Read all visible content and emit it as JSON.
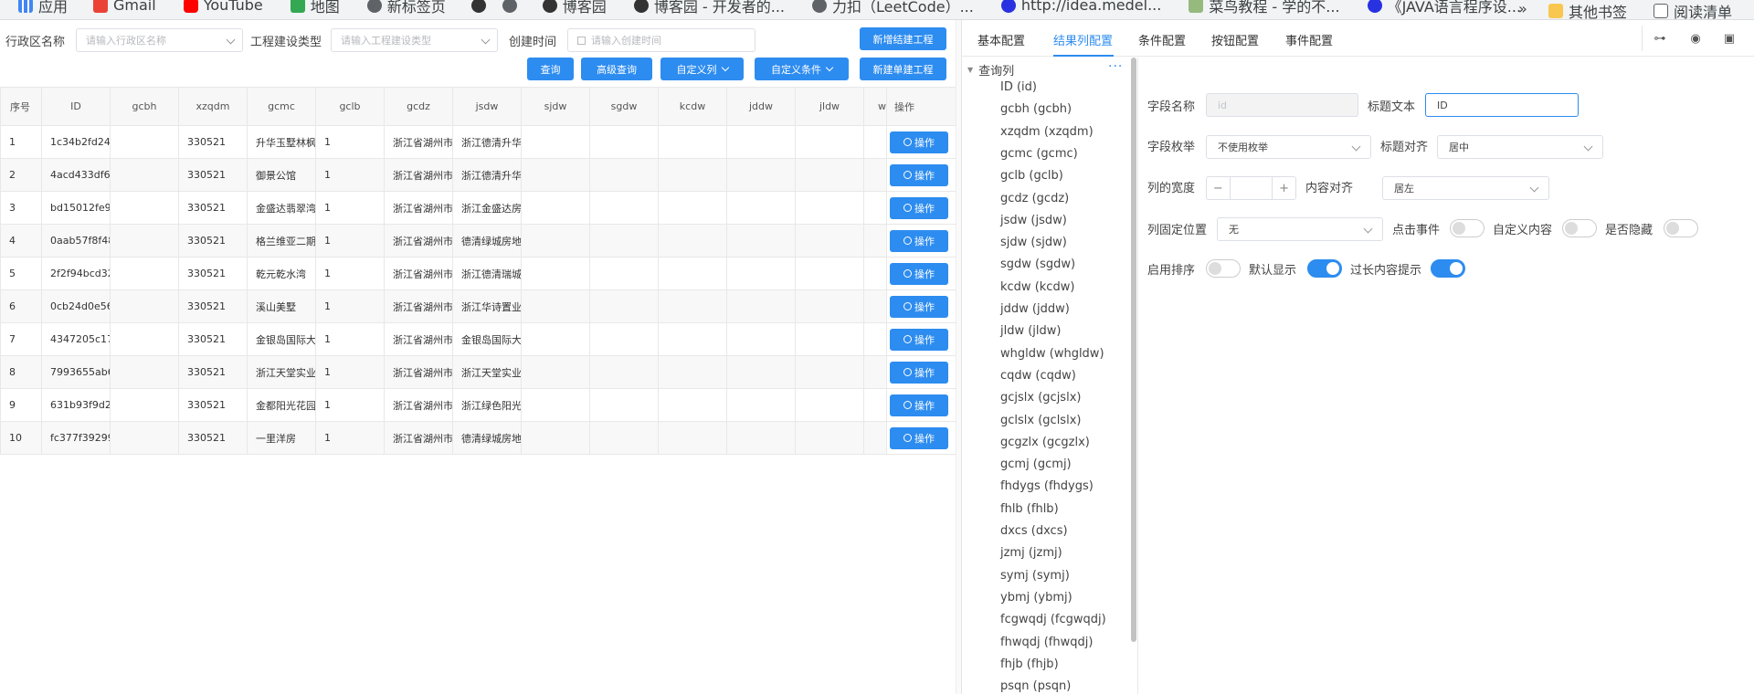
{
  "bookmarks": [
    {
      "label": "应用",
      "icon": "apps-grid-icon",
      "color": "#4285f4"
    },
    {
      "label": "Gmail",
      "icon": "gmail-icon",
      "color": "#ea4335"
    },
    {
      "label": "YouTube",
      "icon": "youtube-icon",
      "color": "#ff0000"
    },
    {
      "label": "地图",
      "icon": "maps-icon",
      "color": "#34a853"
    },
    {
      "label": "新标签页",
      "icon": "globe-icon",
      "color": "#5f6368"
    },
    {
      "label": "",
      "icon": "cnblogs-icon",
      "color": "#333333"
    },
    {
      "label": "",
      "icon": "globe-icon",
      "color": "#5f6368"
    },
    {
      "label": "博客园",
      "icon": "cnblogs-icon",
      "color": "#333333"
    },
    {
      "label": "博客园 - 开发者的...",
      "icon": "cnblogs-icon",
      "color": "#333333"
    },
    {
      "label": "力扣（LeetCode）...",
      "icon": "globe-icon",
      "color": "#5f6368"
    },
    {
      "label": "http://idea.medel...",
      "icon": "link-icon",
      "color": "#2932e1"
    },
    {
      "label": "菜鸟教程 - 学的不...",
      "icon": "runoob-icon",
      "color": "#96b97d"
    },
    {
      "label": "《JAVA语言程序设...",
      "icon": "baidu-icon",
      "color": "#2932e1"
    }
  ],
  "bookmarks_right": {
    "more": "»",
    "other": "其他书签",
    "reading": "阅读清单"
  },
  "filters": {
    "region_label": "行政区名称",
    "region_placeholder": "请输入行政区名称",
    "type_label": "工程建设类型",
    "type_placeholder": "请输入工程建设类型",
    "time_label": "创建时间",
    "time_placeholder": "请输入创建时间"
  },
  "buttons": {
    "new_completed": "新增结建工程",
    "query": "查询",
    "advanced_query": "高级查询",
    "custom_columns": "自定义列",
    "custom_conditions": "自定义条件",
    "new_single": "新建单建工程"
  },
  "table": {
    "headers": [
      "序号",
      "ID",
      "gcbh",
      "xzqdm",
      "gcmc",
      "gclb",
      "gcdz",
      "jsdw",
      "sjdw",
      "sgdw",
      "kcdw",
      "jddw",
      "jldw",
      "w",
      "操作"
    ],
    "op_label": "操作",
    "rows": [
      [
        "1",
        "1c34b2fd24(",
        "",
        "330521",
        "升华玉墅林枫",
        "1",
        "浙江省湖州市",
        "浙江德清升华",
        "",
        "",
        "",
        "",
        "",
        ""
      ],
      [
        "2",
        "4acd433df6l",
        "",
        "330521",
        "御景公馆",
        "1",
        "浙江省湖州市",
        "浙江德清升华",
        "",
        "",
        "",
        "",
        "",
        ""
      ],
      [
        "3",
        "bd15012fe9(",
        "",
        "330521",
        "金盛达翡翠湾",
        "1",
        "浙江省湖州市",
        "浙江金盛达房",
        "",
        "",
        "",
        "",
        "",
        ""
      ],
      [
        "4",
        "0aab57f8f48",
        "",
        "330521",
        "格兰维亚二期",
        "1",
        "浙江省湖州市",
        "德清绿城房地",
        "",
        "",
        "",
        "",
        "",
        ""
      ],
      [
        "5",
        "2f2f94bcd32",
        "",
        "330521",
        "乾元乾水湾",
        "1",
        "浙江省湖州市",
        "浙江德清瑞城",
        "",
        "",
        "",
        "",
        "",
        ""
      ],
      [
        "6",
        "0cb24d0e56",
        "",
        "330521",
        "溪山美墅",
        "1",
        "浙江省湖州市",
        "浙江华诗置业",
        "",
        "",
        "",
        "",
        "",
        ""
      ],
      [
        "7",
        "4347205c17:",
        "",
        "330521",
        "金银岛国际大",
        "1",
        "浙江省湖州市",
        "金银岛国际大",
        "",
        "",
        "",
        "",
        "",
        ""
      ],
      [
        "8",
        "7993655ab6",
        "",
        "330521",
        "浙江天堂实业",
        "1",
        "浙江省湖州市",
        "浙江天堂实业",
        "",
        "",
        "",
        "",
        "",
        ""
      ],
      [
        "9",
        "631b93f9d2l",
        "",
        "330521",
        "金都阳光花园",
        "1",
        "浙江省湖州市",
        "浙江绿色阳光",
        "",
        "",
        "",
        "",
        "",
        ""
      ],
      [
        "10",
        "fc377f39299",
        "",
        "330521",
        "一里洋房",
        "1",
        "浙江省湖州市",
        "德清绿城房地",
        "",
        "",
        "",
        "",
        "",
        ""
      ]
    ]
  },
  "tabs": [
    "基本配置",
    "结果列配置",
    "条件配置",
    "按钮配置",
    "事件配置"
  ],
  "active_tab": "结果列配置",
  "tab_icons": [
    "sitemap-icon",
    "eye-icon",
    "save-icon"
  ],
  "tree": {
    "root": "查询列",
    "more": "···",
    "nodes": [
      "ID (id)",
      "gcbh (gcbh)",
      "xzqdm (xzqdm)",
      "gcmc (gcmc)",
      "gclb (gclb)",
      "gcdz (gcdz)",
      "jsdw (jsdw)",
      "sjdw (sjdw)",
      "sgdw (sgdw)",
      "kcdw (kcdw)",
      "jddw (jddw)",
      "jldw (jldw)",
      "whgldw (whgldw)",
      "cqdw (cqdw)",
      "gcjslx (gcjslx)",
      "gclslx (gclslx)",
      "gcgzlx (gcgzlx)",
      "gcmj (gcmj)",
      "fhdygs (fhdygs)",
      "fhlb (fhlb)",
      "dxcs (dxcs)",
      "jzmj (jzmj)",
      "symj (symj)",
      "ybmj (ybmj)",
      "fcgwqdj (fcgwqdj)",
      "fhwqdj (fhwqdj)",
      "fhjb (fhjb)",
      "psqn (psqn)"
    ]
  },
  "config": {
    "field_name_label": "字段名称",
    "field_name_value": "id",
    "title_text_label": "标题文本",
    "title_text_value": "ID",
    "enum_label": "字段枚举",
    "enum_value": "不使用枚举",
    "title_align_label": "标题对齐",
    "title_align_value": "居中",
    "width_label": "列的宽度",
    "minus": "−",
    "plus": "+",
    "content_align_label": "内容对齐",
    "content_align_value": "居左",
    "fixed_label": "列固定位置",
    "fixed_value": "无",
    "click_event_label": "点击事件",
    "click_event_on": false,
    "custom_content_label": "自定义内容",
    "custom_content_on": false,
    "hidden_label": "是否隐藏",
    "hidden_on": false,
    "sort_label": "启用排序",
    "sort_on": false,
    "default_show_label": "默认显示",
    "default_show_on": true,
    "overflow_tip_label": "过长内容提示",
    "overflow_tip_on": true
  },
  "colors": {
    "accent": "#2d8cf0",
    "border": "#dcdfe6"
  }
}
